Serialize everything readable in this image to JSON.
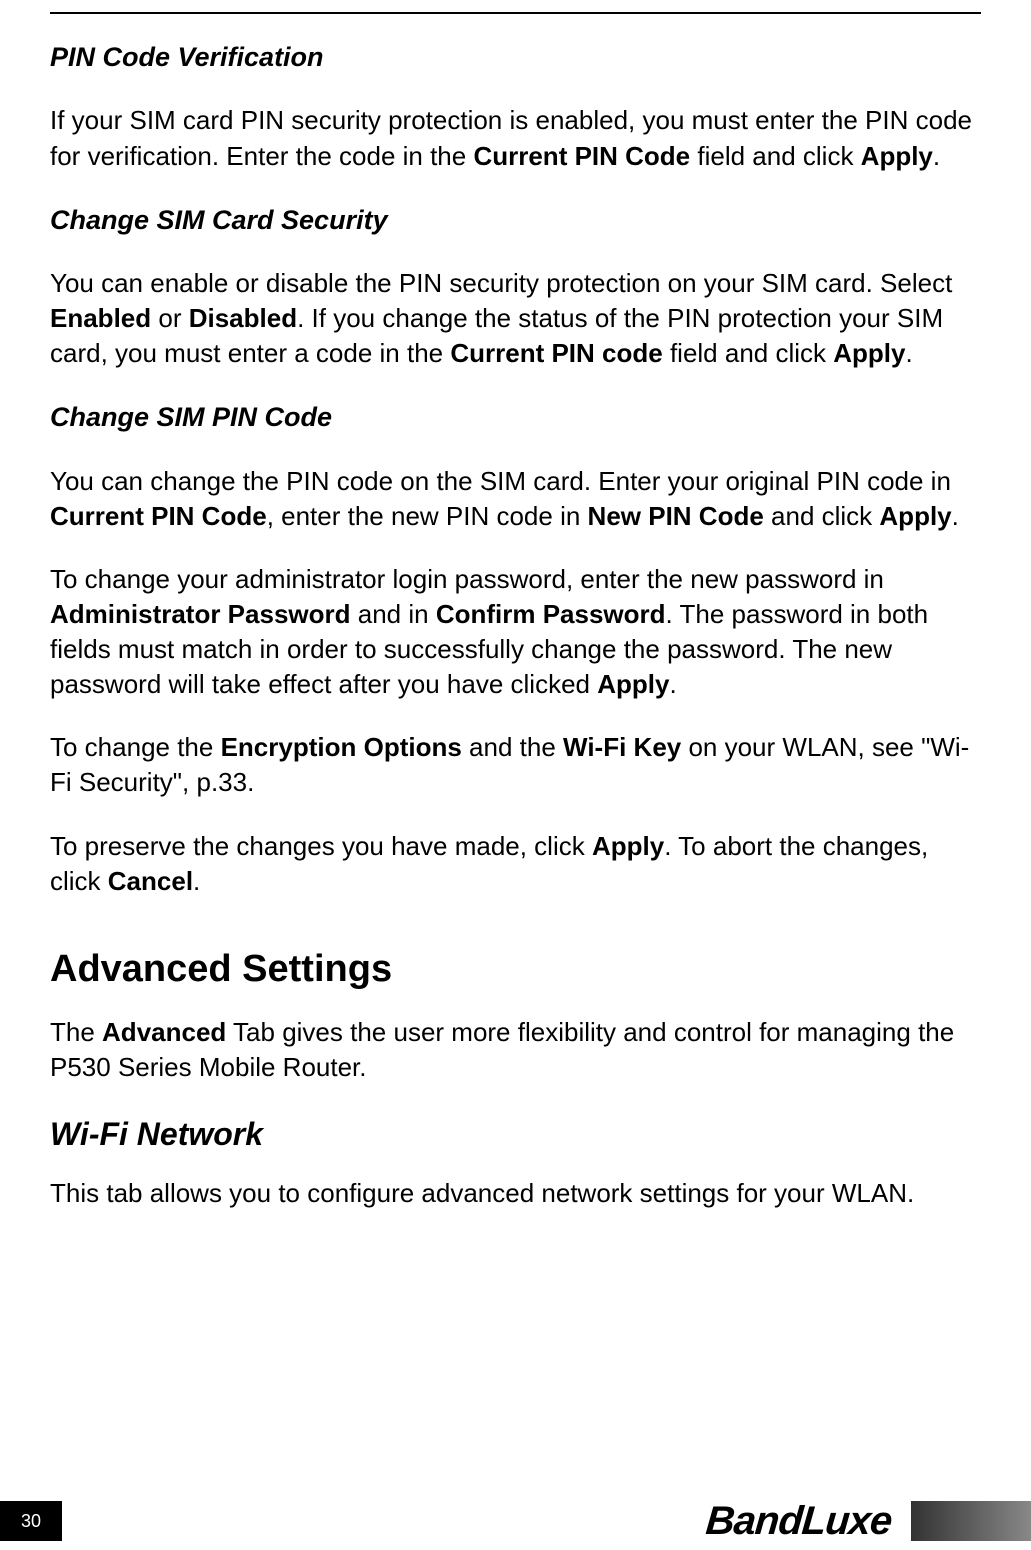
{
  "sections": {
    "pin_verification": {
      "heading": "PIN Code Verification",
      "p1_a": "If your SIM card PIN security protection is enabled, you must enter the PIN code for verification. Enter the code in the ",
      "p1_b": "Current PIN Code",
      "p1_c": " field and click ",
      "p1_d": "Apply",
      "p1_e": "."
    },
    "change_security": {
      "heading": "Change SIM Card Security",
      "p1_a": "You can enable or disable the PIN security protection on your SIM card. Select ",
      "p1_b": "Enabled",
      "p1_c": " or ",
      "p1_d": "Disabled",
      "p1_e": ". If you change the status of the PIN protection your SIM card, you must enter a code in the ",
      "p1_f": "Current PIN code",
      "p1_g": " field and click ",
      "p1_h": "Apply",
      "p1_i": "."
    },
    "change_pin": {
      "heading": "Change SIM PIN Code",
      "p1_a": "You can change the PIN code on the SIM card. Enter your original PIN code in ",
      "p1_b": "Current PIN Code",
      "p1_c": ", enter the new PIN code in ",
      "p1_d": "New PIN Code",
      "p1_e": " and click ",
      "p1_f": "Apply",
      "p1_g": ".",
      "p2_a": "To change your administrator login password, enter the new password in ",
      "p2_b": "Administrator Password",
      "p2_c": " and in ",
      "p2_d": "Confirm Password",
      "p2_e": ". The password in both fields must match in order to successfully change the password. The new password will take effect after you have clicked ",
      "p2_f": "Apply",
      "p2_g": ".",
      "p3_a": "To change the ",
      "p3_b": "Encryption Options",
      "p3_c": " and the ",
      "p3_d": "Wi-Fi Key",
      "p3_e": " on your WLAN, see \"Wi-Fi Security\", p.33.",
      "p4_a": "To preserve the changes you have made, click ",
      "p4_b": "Apply",
      "p4_c": ". To abort the changes, click ",
      "p4_d": "Cancel",
      "p4_e": "."
    },
    "advanced": {
      "heading": "Advanced Settings",
      "p1_a": "The ",
      "p1_b": "Advanced",
      "p1_c": " Tab gives the user more flexibility and control for managing the P530 Series Mobile Router."
    },
    "wifi": {
      "heading": "Wi-Fi Network",
      "p1": "This tab allows you to configure advanced network settings for your WLAN."
    }
  },
  "footer": {
    "page_number": "30",
    "brand": "BandLuxe"
  }
}
